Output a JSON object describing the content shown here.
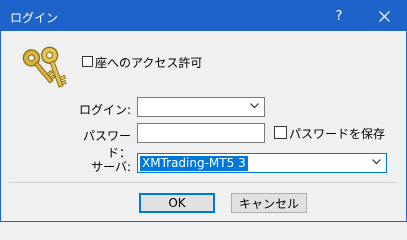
{
  "window": {
    "title": "ログイン",
    "help_label": "?",
    "accent_color": "#1e63c9"
  },
  "icons": {
    "keys": "keys-icon",
    "close": "close-icon",
    "dropdown": "chevron-down-icon"
  },
  "access_section": {
    "label": "座へのアクセス許可"
  },
  "form": {
    "login_label": "ログイン:",
    "login_value": "",
    "password_label": "パスワード：",
    "password_value": "",
    "save_password_label": "パスワードを保存",
    "save_password_checked": false,
    "server_label": "サーバ:",
    "server_value": "XMTrading-MT5 3"
  },
  "buttons": {
    "ok_label": "OK",
    "cancel_label": "キャンセル"
  }
}
